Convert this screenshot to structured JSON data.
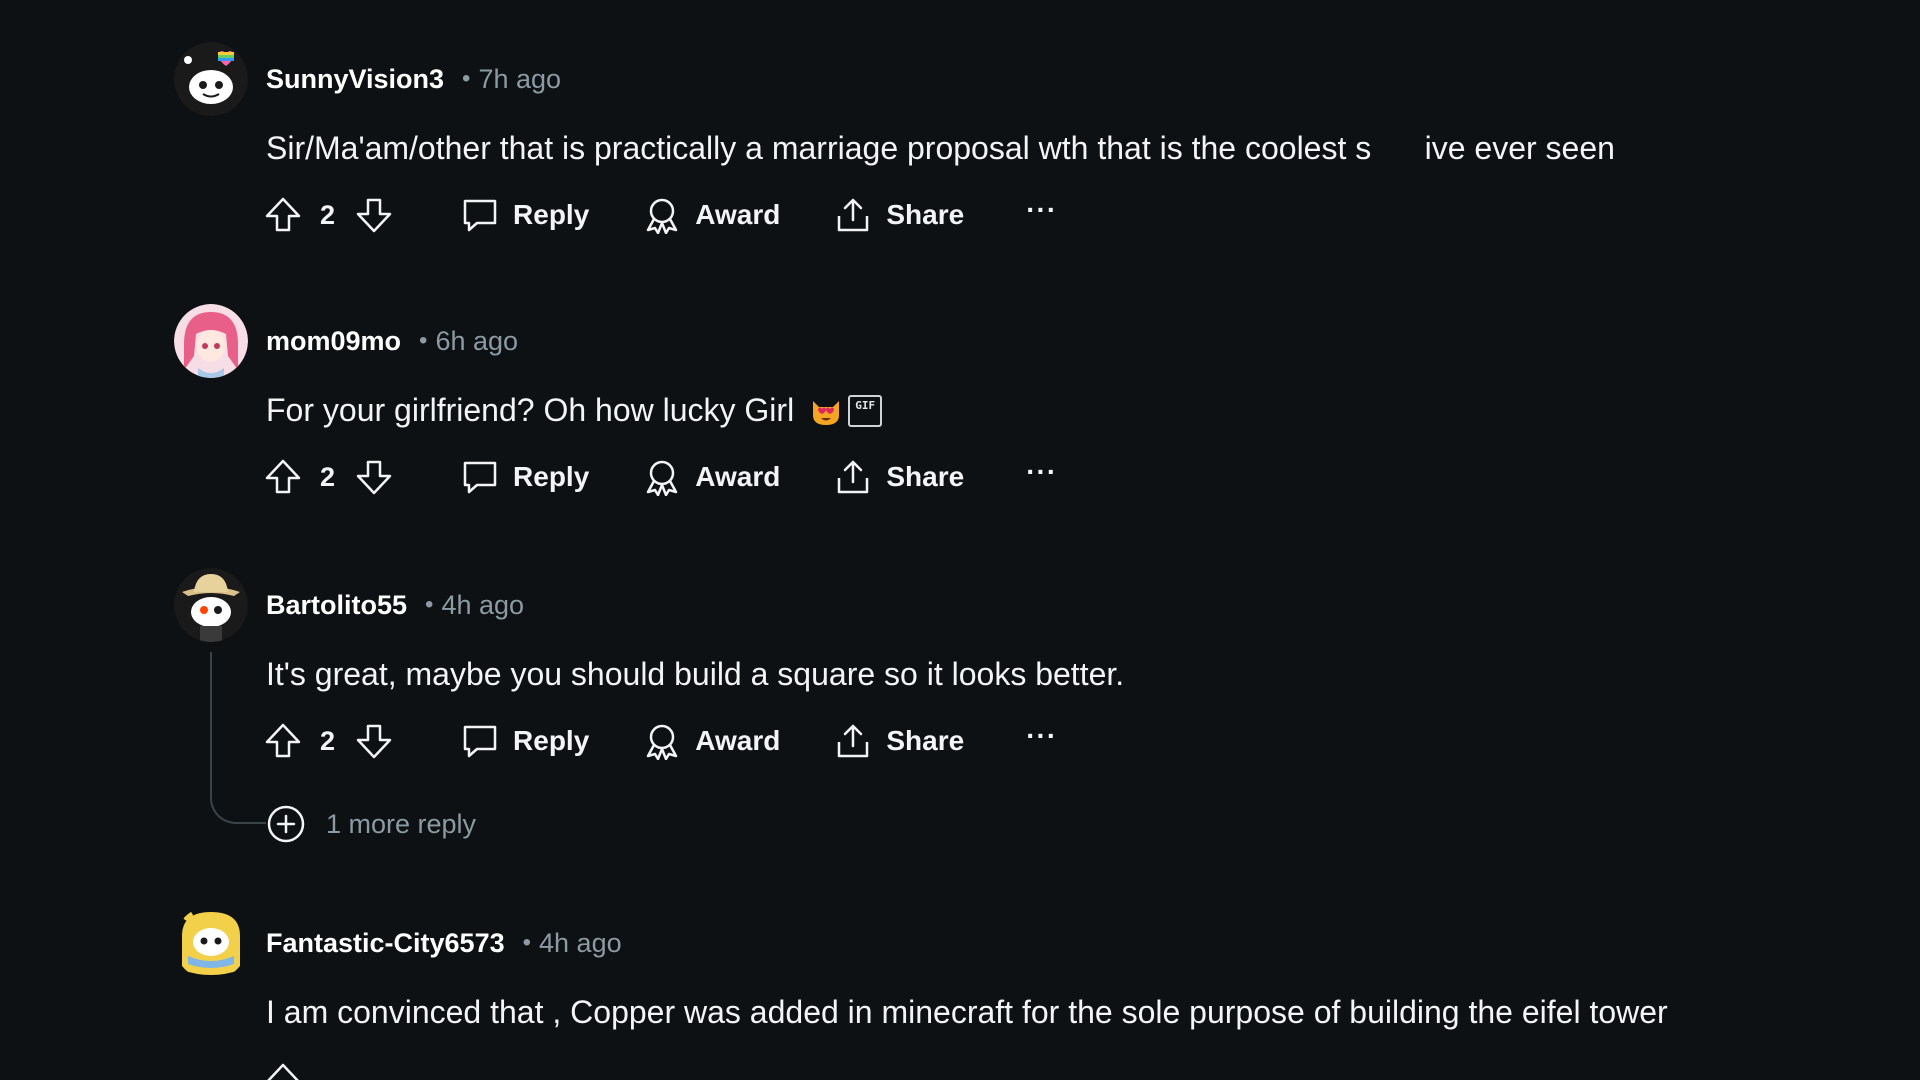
{
  "comments": [
    {
      "username": "SunnyVision3",
      "time": "7h ago",
      "text": "Sir/Ma'am/other that is practically a marriage proposal wth that is the coolest s      ive ever seen",
      "score": "2",
      "reply_label": "Reply",
      "award_label": "Award",
      "share_label": "Share",
      "more_label": "···",
      "avatar": "snoo-avatar-with-rainbow-heart"
    },
    {
      "username": "mom09mo",
      "time": "6h ago",
      "text": "For your girlfriend? Oh how lucky Girl",
      "emoji": "heart-eyes-cat-emoji",
      "gif_badge": "GIF",
      "score": "2",
      "reply_label": "Reply",
      "award_label": "Award",
      "share_label": "Share",
      "more_label": "···",
      "avatar": "anime-girl-pink-hair-avatar"
    },
    {
      "username": "Bartolito55",
      "time": "4h ago",
      "text": "It's great, maybe you should build a square so it looks better.",
      "score": "2",
      "reply_label": "Reply",
      "award_label": "Award",
      "share_label": "Share",
      "more_label": "···",
      "avatar": "snoo-with-hat-avatar",
      "more_replies_label": "1 more reply"
    },
    {
      "username": "Fantastic-City6573",
      "time": "4h ago",
      "text": "I am convinced that , Copper was added in minecraft for the sole purpose of building the eifel tower",
      "avatar": "snoo-yellow-costume-avatar"
    }
  ],
  "separator": "•",
  "colors": {
    "background": "#0e1113",
    "text": "#f2f4f5",
    "muted": "#8b9aa3",
    "thread_line": "#3a4449"
  }
}
